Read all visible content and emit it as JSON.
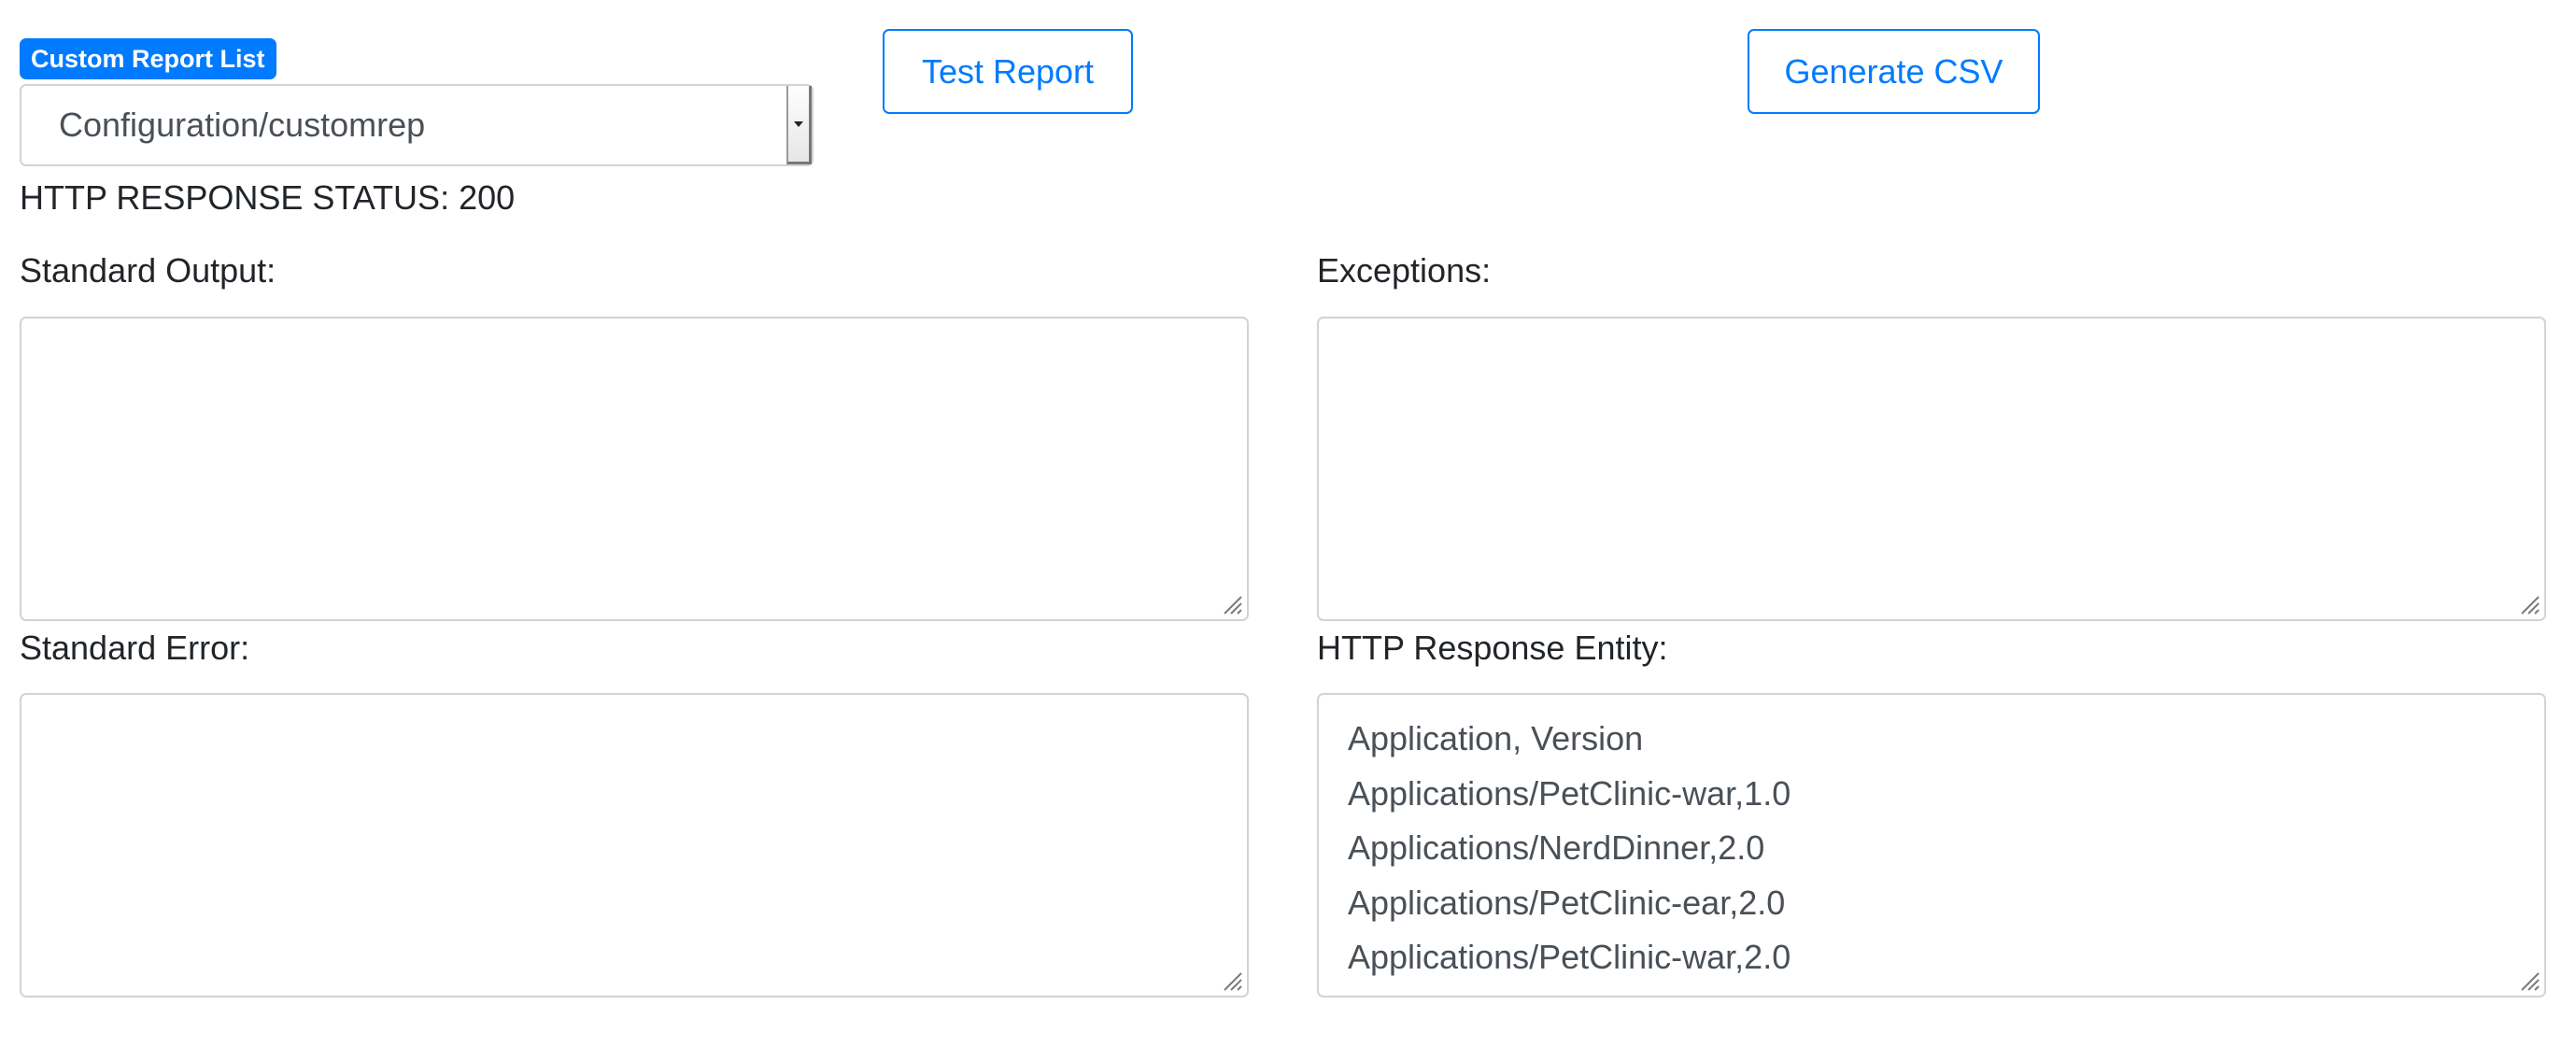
{
  "report_list": {
    "badge_label": "Custom Report List",
    "selected_value": "Configuration/customrep",
    "dropdown_icon": "caret-down-icon"
  },
  "toolbar": {
    "test_label": "Test Report",
    "csv_label": "Generate CSV"
  },
  "status": {
    "text": "HTTP RESPONSE STATUS: 200"
  },
  "panels": {
    "standard_output": {
      "label": "Standard Output:",
      "value": ""
    },
    "exceptions": {
      "label": "Exceptions:",
      "value": ""
    },
    "standard_error": {
      "label": "Standard Error:",
      "value": ""
    },
    "response_entity": {
      "label": "HTTP Response Entity:",
      "lines": [
        "Application, Version",
        "Applications/PetClinic-war,1.0",
        "Applications/NerdDinner,2.0",
        "Applications/PetClinic-ear,2.0",
        "Applications/PetClinic-war,2.0"
      ]
    }
  },
  "colors": {
    "accent": "#007bff",
    "border": "#ced4da",
    "text": "#212529",
    "muted_text": "#495057"
  }
}
